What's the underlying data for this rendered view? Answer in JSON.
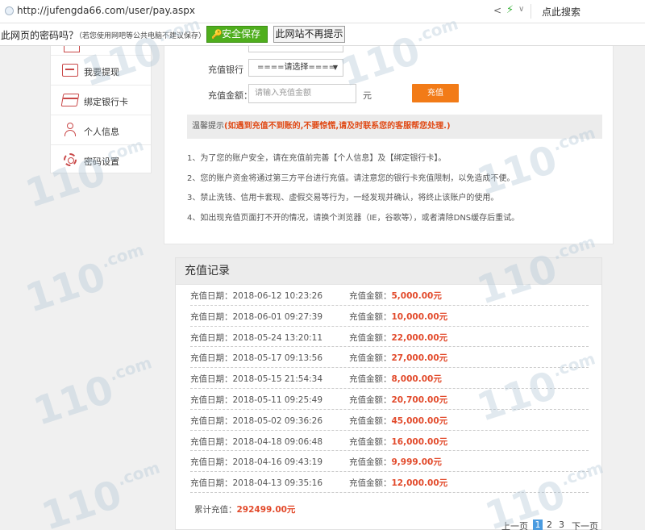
{
  "browser": {
    "url": "http://jufengda66.com/user/pay.aspx",
    "search_label": "点此搜索"
  },
  "password_bar": {
    "question": "此网页的密码吗？",
    "tip": "（若您使用网吧等公共电脑不建议保存）",
    "save_label": "安全保存",
    "never_label": "此网站不再提示"
  },
  "sidebar": {
    "items": [
      {
        "label": "我要提现",
        "icon": "withdraw-icon"
      },
      {
        "label": "绑定银行卡",
        "icon": "bank-card-icon"
      },
      {
        "label": "个人信息",
        "icon": "user-icon"
      },
      {
        "label": "密码设置",
        "icon": "gear-icon"
      }
    ]
  },
  "recharge_form": {
    "bank_label": "充值银行",
    "bank_selected": "====请选择====",
    "amount_label": "充值金额：",
    "amount_placeholder": "请输入充值金额",
    "unit": "元",
    "submit_label": "充值"
  },
  "notice": {
    "prefix": "温馨提示",
    "warning": "(如遇到充值不到账的,不要惊慌,请及时联系您的客服帮您处理.)"
  },
  "rules": [
    "1、为了您的账户安全，请在充值前完善【个人信息】及【绑定银行卡】。",
    "2、您的账户资金将通过第三方平台进行充值。请注意您的银行卡充值限制，以免造成不便。",
    "3、禁止洗钱、信用卡套现、虚假交易等行为，一经发现并确认，将终止该账户的使用。",
    "4、如出现充值页面打不开的情况，请换个浏览器（IE，谷歌等），或者清除DNS缓存后重试。"
  ],
  "records": {
    "title": "充值记录",
    "date_prefix": "充值日期：",
    "amount_prefix": "充值金额：",
    "rows": [
      {
        "date": "2018-06-12 10:23:26",
        "amount": "5,000.00元"
      },
      {
        "date": "2018-06-01 09:27:39",
        "amount": "10,000.00元"
      },
      {
        "date": "2018-05-24 13:20:11",
        "amount": "22,000.00元"
      },
      {
        "date": "2018-05-17 09:13:56",
        "amount": "27,000.00元"
      },
      {
        "date": "2018-05-15 21:54:34",
        "amount": "8,000.00元"
      },
      {
        "date": "2018-05-11 09:25:49",
        "amount": "20,700.00元"
      },
      {
        "date": "2018-05-02 09:36:26",
        "amount": "45,000.00元"
      },
      {
        "date": "2018-04-18 09:06:48",
        "amount": "16,000.00元"
      },
      {
        "date": "2018-04-16 09:43:19",
        "amount": "9,999.00元"
      },
      {
        "date": "2018-04-13 09:35:16",
        "amount": "12,000.00元"
      }
    ],
    "total_label": "累计充值：",
    "total_value": "292499.00元"
  },
  "pagination": {
    "prev": "上一页",
    "pages": [
      "1",
      "2",
      "3"
    ],
    "current": "1",
    "next": "下一页"
  },
  "watermark": {
    "text": "110",
    "suffix": ".com"
  },
  "colors": {
    "accent_orange": "#f27b17",
    "warning_red": "#e04a16",
    "amount_red": "#e24a2b",
    "save_green": "#4fae1d",
    "page_blue": "#4a9be0"
  }
}
